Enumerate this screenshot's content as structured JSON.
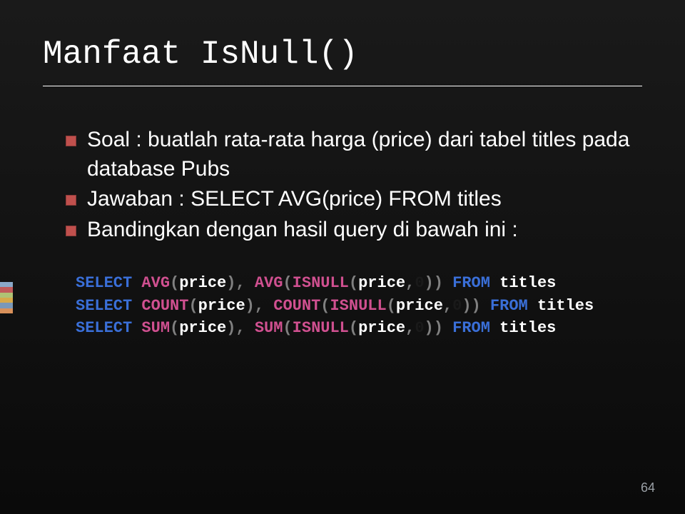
{
  "title": "Manfaat IsNull()",
  "bullets": [
    "Soal : buatlah rata-rata harga (price) dari tabel titles pada database Pubs",
    "Jawaban : SELECT AVG(price) FROM titles",
    "Bandingkan dengan hasil query di bawah ini :"
  ],
  "code": {
    "line1": {
      "p1": "SELECT ",
      "p2": "AVG",
      "p3": "(",
      "p4": "price",
      "p5": "),",
      "p6": " ",
      "p7": "AVG",
      "p8": "(",
      "p9": "ISNULL",
      "p10": "(",
      "p11": "price",
      "p12": ",",
      "p13": "0",
      "p14": "))",
      "p15": " FROM ",
      "p16": " titles"
    },
    "line2": {
      "p1": "SELECT ",
      "p2": "COUNT",
      "p3": "(",
      "p4": "price",
      "p5": "),",
      "p6": " ",
      "p7": "COUNT",
      "p8": "(",
      "p9": "ISNULL",
      "p10": "(",
      "p11": "price",
      "p12": ",",
      "p13": "0",
      "p14": "))",
      "p15": " FROM ",
      "p16": " titles"
    },
    "line3": {
      "p1": "SELECT ",
      "p2": "SUM",
      "p3": "(",
      "p4": "price",
      "p5": "),",
      "p6": " ",
      "p7": "SUM",
      "p8": "(",
      "p9": "ISNULL",
      "p10": "(",
      "p11": "price",
      "p12": ",",
      "p13": "0",
      "p14": "))",
      "p15": " FROM ",
      "p16": " titles"
    }
  },
  "pagenum": "64"
}
